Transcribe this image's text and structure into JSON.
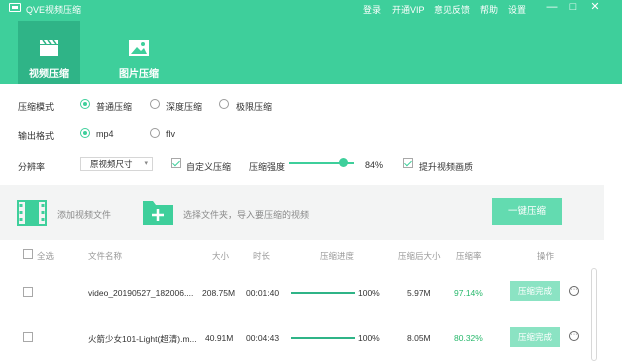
{
  "app": {
    "title": "QVE视频压缩"
  },
  "top_links": {
    "login": "登录",
    "vip": "开通VIP",
    "feedback": "意见反馈",
    "help": "帮助",
    "settings": "设置"
  },
  "window_controls": {
    "minimize": "—",
    "maximize": "□",
    "close": "✕"
  },
  "modes": {
    "video": "视频压缩",
    "image": "图片压缩",
    "active": "video"
  },
  "settings": {
    "compress_mode": {
      "label": "压缩模式",
      "options": [
        "普通压缩",
        "深度压缩",
        "极限压缩"
      ],
      "selected": "普通压缩"
    },
    "output_format": {
      "label": "输出格式",
      "options": [
        "mp4",
        "flv"
      ],
      "selected": "mp4"
    },
    "resolution": {
      "label": "分辨率",
      "value": "原视频尺寸"
    },
    "custom_compress": {
      "label": "自定义压缩",
      "checked": true
    },
    "strength": {
      "label": "压缩强度",
      "value": "84%",
      "level": 0.84
    },
    "enhance": {
      "label": "提升视频画质",
      "checked": true
    }
  },
  "toolbar": {
    "add_video": "添加视频文件",
    "choose_folder": "选择文件夹，导入要压缩的视频",
    "compress_all": "一键压缩"
  },
  "columns": {
    "select_all": "全选",
    "file_name": "文件名称",
    "size": "大小",
    "duration": "时长",
    "progress": "压缩进度",
    "compressed_size": "压缩后大小",
    "rate": "压缩率",
    "action": "操作"
  },
  "files": [
    {
      "name": "video_20190527_182006....",
      "size": "208.75M",
      "duration": "00:01:40",
      "progress": "100%",
      "progress_value": 1.0,
      "compressed_size": "5.97M",
      "rate": "97.14%",
      "action": "压缩完成",
      "more": "···"
    },
    {
      "name": "火箭少女101-Light(超清).m...",
      "size": "40.91M",
      "duration": "00:04:43",
      "progress": "100%",
      "progress_value": 1.0,
      "compressed_size": "8.05M",
      "rate": "80.32%",
      "action": "压缩完成",
      "more": "···"
    }
  ],
  "colors": {
    "brand": "#3ecf9b",
    "brand_dark": "#2fb487",
    "rate_text": "#27b86b"
  }
}
